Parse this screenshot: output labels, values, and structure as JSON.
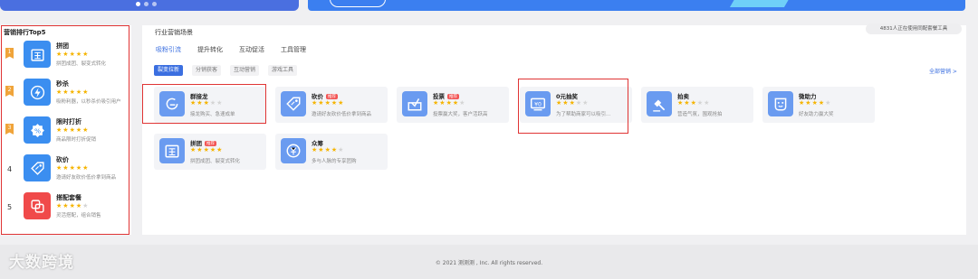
{
  "top": {
    "banner_dots": 3
  },
  "left_panel": {
    "title": "营销排行Top5",
    "items": [
      {
        "rank": "1",
        "flag": true,
        "name": "拼团",
        "rating": 5,
        "desc": "拼团成团、裂变式转化",
        "icon": "pin-icon",
        "color": "#3b8ef0"
      },
      {
        "rank": "2",
        "flag": true,
        "name": "秒杀",
        "rating": 5,
        "desc": "吸粉利器，以秒杀价吸引用户",
        "icon": "lightning-icon",
        "color": "#3b8ef0"
      },
      {
        "rank": "3",
        "flag": true,
        "name": "限时打折",
        "rating": 5,
        "desc": "商品限时打折促销",
        "icon": "percent-icon",
        "color": "#3b8ef0"
      },
      {
        "rank": "4",
        "flag": false,
        "name": "砍价",
        "rating": 5,
        "desc": "邀请好友砍价低价拿到商品",
        "icon": "tag-icon",
        "color": "#3b8ef0"
      },
      {
        "rank": "5",
        "flag": false,
        "name": "搭配套餐",
        "rating": 4,
        "desc": "灵活搭配，组合销售",
        "icon": "combo-icon",
        "color": "#f04a4a"
      }
    ]
  },
  "main": {
    "title": "行业营销场景",
    "online_badge": "4831人正在使用同配套餐工具",
    "tabs": [
      "吸粉引流",
      "提升转化",
      "互动促活",
      "工具管理"
    ],
    "subtabs": [
      "裂变拉新",
      "分销获客",
      "互动营销",
      "游戏工具"
    ],
    "all_link": "全部营销 >",
    "hot_label": "推荐",
    "cards": [
      {
        "name": "群接龙",
        "rating": 3,
        "desc": "接龙购买、急速成单",
        "icon": "group-solitaire-icon",
        "hot": false
      },
      {
        "name": "砍价",
        "rating": 5,
        "desc": "邀请好友砍价低价拿到商品",
        "icon": "tag-icon",
        "hot": true
      },
      {
        "name": "投票",
        "rating": 4,
        "desc": "投票赢大奖，客户活跃高",
        "icon": "vote-icon",
        "hot": true
      },
      {
        "name": "0元抽奖",
        "rating": 3,
        "desc": "为了帮助商家可以吸引...",
        "icon": "lottery-icon",
        "hot": false
      },
      {
        "name": "拍卖",
        "rating": 3,
        "desc": "营造气氛，围观抢拍",
        "icon": "auction-icon",
        "hot": false
      },
      {
        "name": "微助力",
        "rating": 4,
        "desc": "好友助力赢大奖",
        "icon": "smile-icon",
        "hot": false
      },
      {
        "name": "拼团",
        "rating": 5,
        "desc": "拼团成团、裂变式转化",
        "icon": "pin-icon",
        "hot": true
      },
      {
        "name": "众筹",
        "rating": 4,
        "desc": "多与人脉的专享团购",
        "icon": "crowdfund-icon",
        "hot": false
      }
    ]
  },
  "footer": {
    "copyright": "© 2021 测测测 , Inc. All rights reserved.",
    "watermark": "大数跨境"
  }
}
